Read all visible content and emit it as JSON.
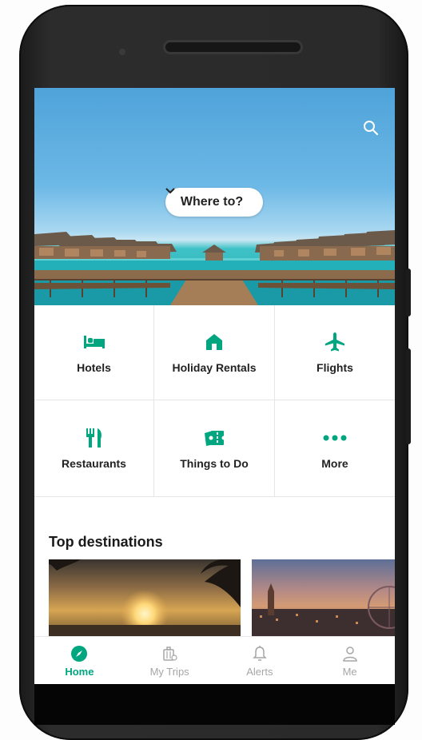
{
  "hero": {
    "where_to_label": "Where to?",
    "search_icon": "search-icon",
    "chevron_icon": "chevron-down-icon"
  },
  "categories": [
    {
      "label": "Hotels",
      "icon": "bed-icon"
    },
    {
      "label": "Holiday Rentals",
      "icon": "house-icon"
    },
    {
      "label": "Flights",
      "icon": "plane-icon"
    },
    {
      "label": "Restaurants",
      "icon": "fork-knife-icon"
    },
    {
      "label": "Things to Do",
      "icon": "ticket-icon"
    },
    {
      "label": "More",
      "icon": "more-dots-icon"
    }
  ],
  "top_destinations": {
    "title": "Top destinations"
  },
  "bottom_nav": {
    "items": [
      {
        "label": "Home",
        "icon": "compass-icon",
        "active": true
      },
      {
        "label": "My Trips",
        "icon": "luggage-icon",
        "active": false
      },
      {
        "label": "Alerts",
        "icon": "bell-icon",
        "active": false
      },
      {
        "label": "Me",
        "icon": "person-icon",
        "active": false
      }
    ]
  },
  "colors": {
    "accent": "#00a680",
    "inactive": "#a6a6a6",
    "text": "#222222"
  }
}
